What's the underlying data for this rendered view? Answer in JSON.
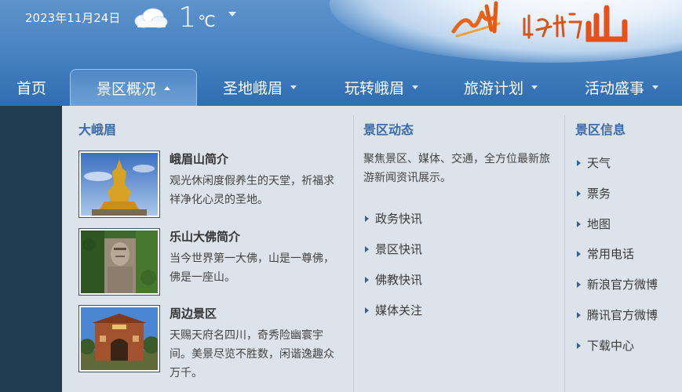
{
  "header": {
    "date": "2023年11月24日",
    "weather_icon": "cloud-icon",
    "temperature": "1",
    "temperature_unit": "℃"
  },
  "logo_text": "峨眉山",
  "nav": [
    {
      "label": "首页"
    },
    {
      "label": "景区概况"
    },
    {
      "label": "圣地峨眉"
    },
    {
      "label": "玩转峨眉"
    },
    {
      "label": "旅游计划"
    },
    {
      "label": "活动盛事"
    }
  ],
  "menu": {
    "col1": {
      "title": "大峨眉",
      "items": [
        {
          "title": "峨眉山简介",
          "desc": "观光休闲度假养生的天堂，祈福求祥净化心灵的圣地。",
          "image": "golden-buddha-image"
        },
        {
          "title": "乐山大佛简介",
          "desc": "当今世界第一大佛，山是一尊佛，佛是一座山。",
          "image": "leshan-buddha-image"
        },
        {
          "title": "周边景区",
          "desc": "天赐天府名四川，奇秀险幽寰宇间。美景尽览不胜数，闲谐逸趣众万千。",
          "image": "gate-building-image"
        }
      ]
    },
    "col2": {
      "title": "景区动态",
      "desc": "聚焦景区、媒体、交通，全方位最新旅游新闻资讯展示。",
      "links": [
        "政务快讯",
        "景区快讯",
        "佛教快讯",
        "媒体关注"
      ]
    },
    "col3": {
      "title": "景区信息",
      "links": [
        "天气",
        "票务",
        "地图",
        "常用电话",
        "新浪官方微博",
        "腾讯官方微博",
        "下载中心"
      ]
    }
  },
  "colors": {
    "header_blue": "#4a84c2",
    "panel_bg": "#dce3ea",
    "title_blue": "#3c6aa5",
    "sidebar_dark": "#1f3d4f"
  }
}
